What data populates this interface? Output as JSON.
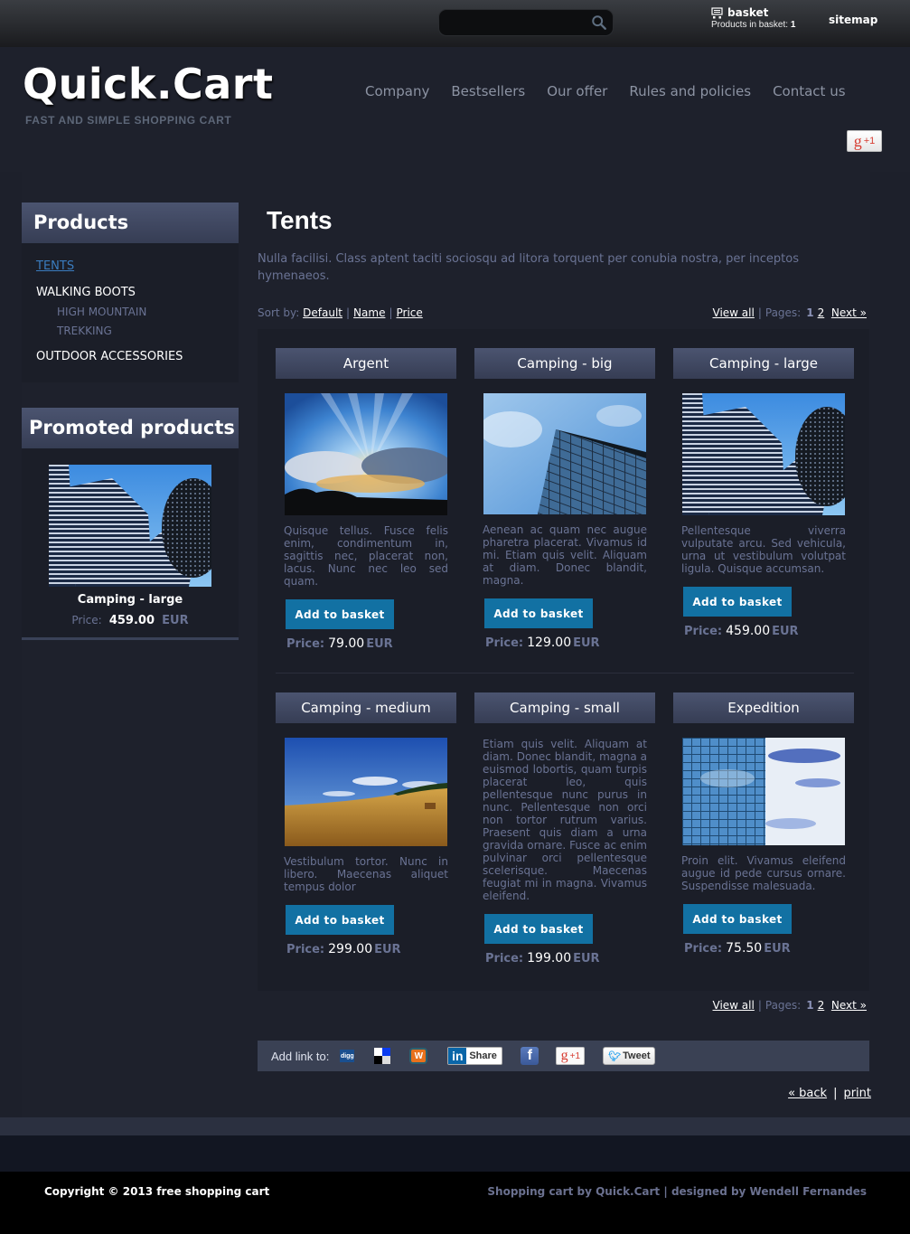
{
  "topbar": {
    "search": {
      "value": "",
      "placeholder": ""
    },
    "basket": {
      "label": "basket",
      "count_label": "Products in basket:",
      "count": "1"
    },
    "sitemap": "sitemap"
  },
  "header": {
    "logo": "Quick.Cart",
    "tagline": "FAST AND SIMPLE SHOPPING CART",
    "nav": [
      "Company",
      "Bestsellers",
      "Our offer",
      "Rules and policies",
      "Contact us"
    ],
    "gplus": "+1"
  },
  "sidebar": {
    "products_title": "Products",
    "categories": [
      {
        "label": "TENTS",
        "active": true
      },
      {
        "label": "WALKING BOOTS",
        "children": [
          "HIGH MOUNTAIN",
          "TREKKING"
        ]
      },
      {
        "label": "OUTDOOR ACCESSORIES"
      }
    ],
    "promoted_title": "Promoted products",
    "promoted": {
      "name": "Camping - large",
      "price_label": "Price:",
      "price": "459.00",
      "currency": "EUR",
      "image": "skyscrapers"
    }
  },
  "main": {
    "title": "Tents",
    "description": "Nulla facilisi. Class aptent taciti sociosqu ad litora torquent per conubia nostra, per inceptos hymenaeos.",
    "sort": {
      "label": "Sort by:",
      "options": [
        "Default",
        "Name",
        "Price"
      ]
    },
    "pager": {
      "view_all": "View all",
      "pages_label": "Pages:",
      "current": "1",
      "next_page": "2",
      "next": "Next »"
    },
    "add_to_basket": "Add to basket",
    "price_label": "Price:",
    "currency": "EUR",
    "products": [
      {
        "name": "Argent",
        "image": "sunrays-clouds",
        "description": "Quisque tellus. Fusce felis enim, condimentum in, sagittis nec, placerat non, lacus. Nunc nec leo sed quam.",
        "price": "79.00"
      },
      {
        "name": "Camping - big",
        "image": "glass-tower-sky",
        "description": "Aenean ac quam nec augue pharetra placerat. Vivamus id mi. Etiam quis velit. Aliquam at diam. Donec blandit, magna.",
        "price": "129.00"
      },
      {
        "name": "Camping - large",
        "image": "skyscrapers",
        "description": "Pellentesque viverra vulputate arcu. Sed vehicula, urna ut vestibulum volutpat ligula. Quisque accumsan.",
        "price": "459.00"
      },
      {
        "name": "Camping - medium",
        "image": "wheat-field",
        "description": "Vestibulum tortor. Nunc in libero. Maecenas aliquet tempus dolor",
        "price": "299.00"
      },
      {
        "name": "Camping - small",
        "image": null,
        "description": "Etiam quis velit. Aliquam at diam. Donec blandit, magna a euismod lobortis, quam turpis placerat leo, quis pellentesque nunc purus in nunc. Pellentesque non orci non tortor rutrum varius. Praesent quis diam a urna gravida ornare. Fusce ac enim pulvinar orci pellentesque scelerisque. Maecenas feugiat mi in magna. Vivamus eleifend.",
        "price": "199.00"
      },
      {
        "name": "Expedition",
        "image": "glass-facade-clouds",
        "description": "Proin elit. Vivamus eleifend augue id pede cursus ornare. Suspendisse malesuada.",
        "price": "75.50"
      }
    ],
    "share": {
      "label": "Add link to:",
      "services": [
        "digg",
        "delicious",
        "wykop",
        "linkedin",
        "facebook",
        "google-plus",
        "twitter"
      ],
      "digg": "digg",
      "linkedin": "Share",
      "gplus": "+1",
      "tweet": "Tweet"
    },
    "back": "« back",
    "print": "print"
  },
  "footer": {
    "copyright": "Copyright © 2013 free shopping cart",
    "credits_prefix": "Shopping cart by",
    "credits_link": "Quick.Cart",
    "credits_sep": "|",
    "designed_by": "designed by Wendell Fernandes"
  },
  "colors": {
    "accent": "#1271a3",
    "link_active": "#3a7cbf",
    "panel_head": "#4b5470",
    "background": "#1e212c"
  }
}
